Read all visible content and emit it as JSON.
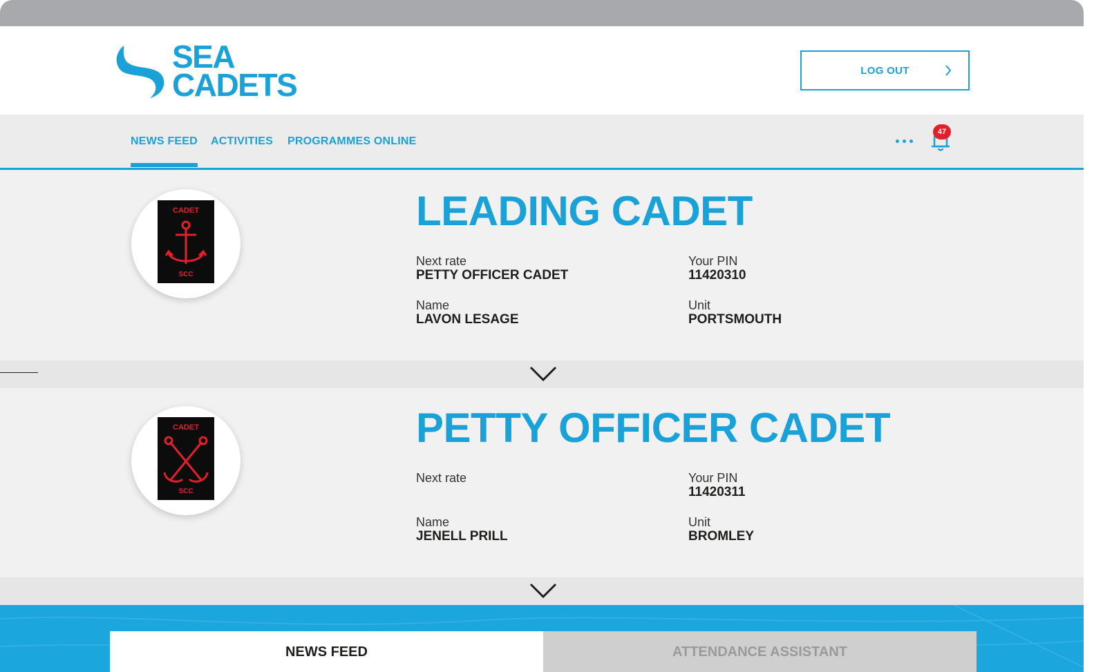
{
  "header": {
    "logo_line1": "SEA",
    "logo_line2": "CADETS",
    "logout_label": "LOG OUT"
  },
  "nav": {
    "items": [
      {
        "label": "NEWS FEED",
        "active": true
      },
      {
        "label": "ACTIVITIES",
        "active": false
      },
      {
        "label": "PROGRAMMES ONLINE",
        "active": false
      }
    ],
    "notification_count": "47",
    "icons": {
      "more": "more-icon",
      "bell": "bell-icon",
      "chevron": "chevron-right-icon"
    }
  },
  "ranks": [
    {
      "title": "LEADING CADET",
      "patch_top": "CADET",
      "patch_bottom": "SCC",
      "next_rate_label": "Next rate",
      "next_rate_value": "PETTY OFFICER CADET",
      "pin_label": "Your PIN",
      "pin_value": "11420310",
      "name_label": "Name",
      "name_value": "LAVON LESAGE",
      "unit_label": "Unit",
      "unit_value": "PORTSMOUTH"
    },
    {
      "title": "PETTY OFFICER CADET",
      "patch_top": "CADET",
      "patch_bottom": "SCC",
      "next_rate_label": "Next rate",
      "next_rate_value": "",
      "pin_label": "Your PIN",
      "pin_value": "11420311",
      "name_label": "Name",
      "name_value": "JENELL PRILL",
      "unit_label": "Unit",
      "unit_value": "BROMLEY"
    }
  ],
  "bottom_tabs": {
    "news_feed": "NEWS FEED",
    "attendance": "ATTENDANCE ASSISTANT"
  },
  "colors": {
    "brand_blue": "#1aa1d8",
    "badge_red": "#e3202a",
    "chrome_grey": "#a7a9ac"
  }
}
